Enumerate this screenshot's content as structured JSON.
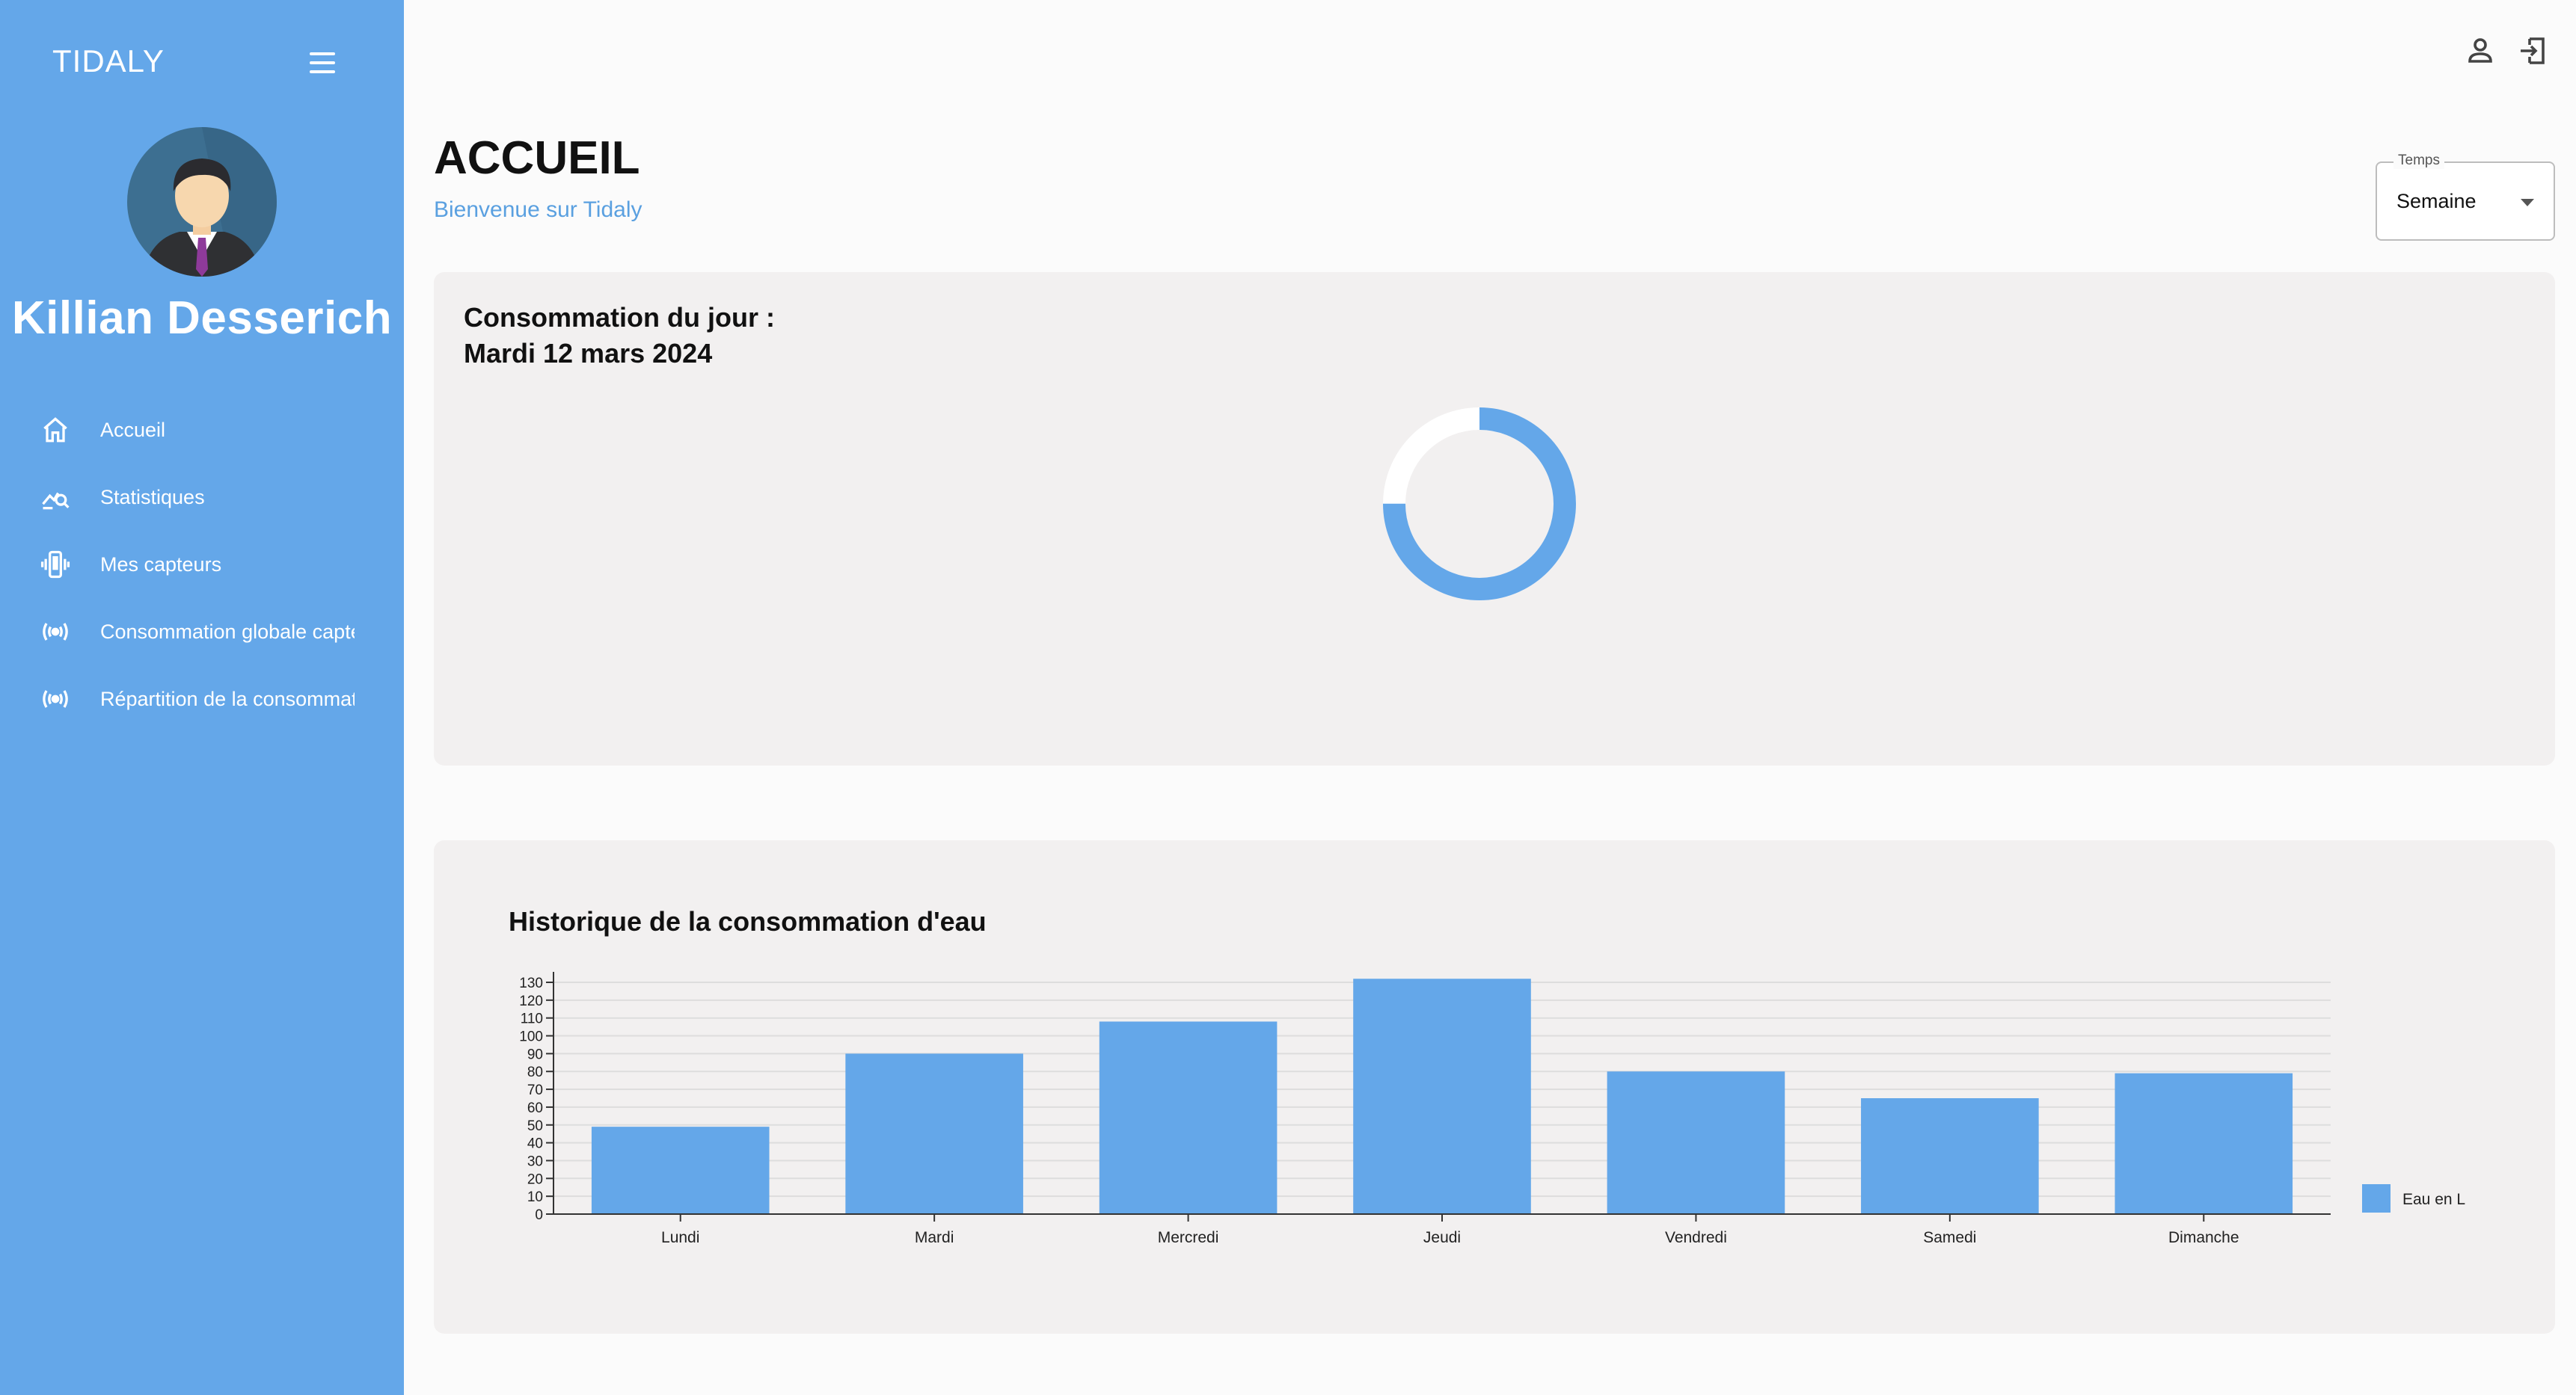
{
  "app": {
    "brand": "TIDALY"
  },
  "user": {
    "name": "Killian Desserich"
  },
  "sidebar": {
    "items": [
      {
        "label": "Accueil",
        "icon": "home-icon"
      },
      {
        "label": "Statistiques",
        "icon": "chart-search-icon"
      },
      {
        "label": "Mes capteurs",
        "icon": "vibrating-phone-icon"
      },
      {
        "label": "Consommation globale capteurs",
        "icon": "broadcast-icon"
      },
      {
        "label": "Répartition de la consommation",
        "icon": "broadcast-icon"
      }
    ]
  },
  "header": {
    "title": "ACCUEIL",
    "subtitle": "Bienvenue sur Tidaly",
    "account_icon": "account-icon",
    "logout_icon": "logout-icon"
  },
  "time_select": {
    "label": "Temps",
    "value": "Semaine"
  },
  "daily": {
    "title_line1": "Consommation du jour :",
    "title_line2": "Mardi 12 mars 2024",
    "progress_fraction": 0.75
  },
  "history": {
    "title": "Historique de la consommation d'eau"
  },
  "colors": {
    "accent": "#64a7e9",
    "bar": "#64a7e9",
    "card": "#f2f0f0"
  },
  "chart_data": {
    "type": "bar",
    "title": "Historique de la consommation d'eau",
    "categories": [
      "Lundi",
      "Mardi",
      "Mercredi",
      "Jeudi",
      "Vendredi",
      "Samedi",
      "Dimanche"
    ],
    "series": [
      {
        "name": "Eau en L",
        "values": [
          49,
          90,
          108,
          132,
          80,
          65,
          79
        ]
      }
    ],
    "ylim": [
      0,
      130
    ],
    "yticks": [
      "0",
      "10",
      "20",
      "30",
      "40",
      "50",
      "60",
      "70",
      "80",
      "90",
      "100",
      "110",
      "120",
      "130"
    ],
    "grid": true,
    "legend_position": "right"
  }
}
